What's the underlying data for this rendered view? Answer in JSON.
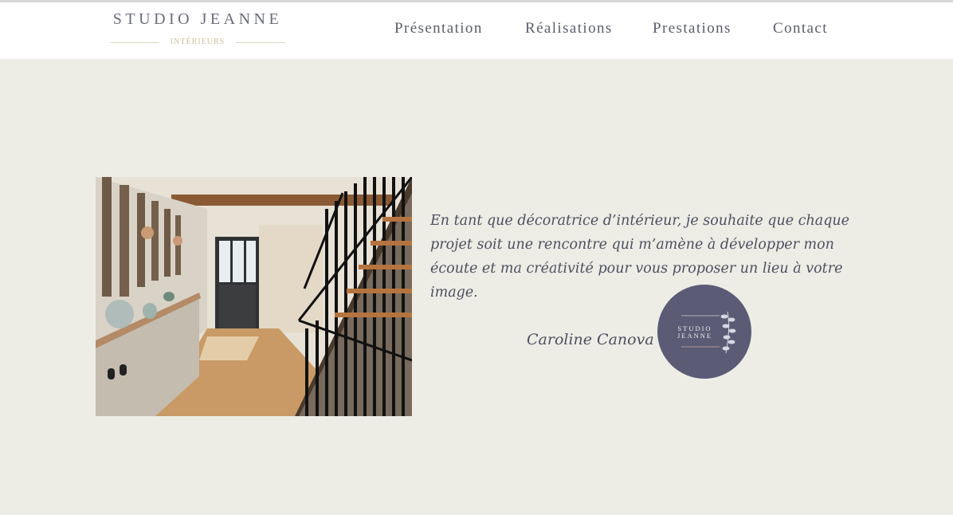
{
  "brand": {
    "name": "STUDIO JEANNE",
    "subtitle": "INTÉRIEURS"
  },
  "nav": {
    "items": [
      {
        "label": "Présentation"
      },
      {
        "label": "Réalisations"
      },
      {
        "label": "Prestations"
      },
      {
        "label": "Contact"
      }
    ]
  },
  "main": {
    "quote": "En tant que décoratrice d’intérieur, je souhaite que chaque projet soit une rencontre qui m’amène à développer mon écoute et ma créativité pour vous proposer un lieu à votre image.",
    "signature": "Caroline Canova",
    "badge_logo_text": "STUDIO JEANNE"
  },
  "colors": {
    "page_background": "#edede6",
    "header_background": "#ffffff",
    "text": "#4e5060",
    "badge": "#5b5b76",
    "logo_accent": "#cbbf9a"
  }
}
